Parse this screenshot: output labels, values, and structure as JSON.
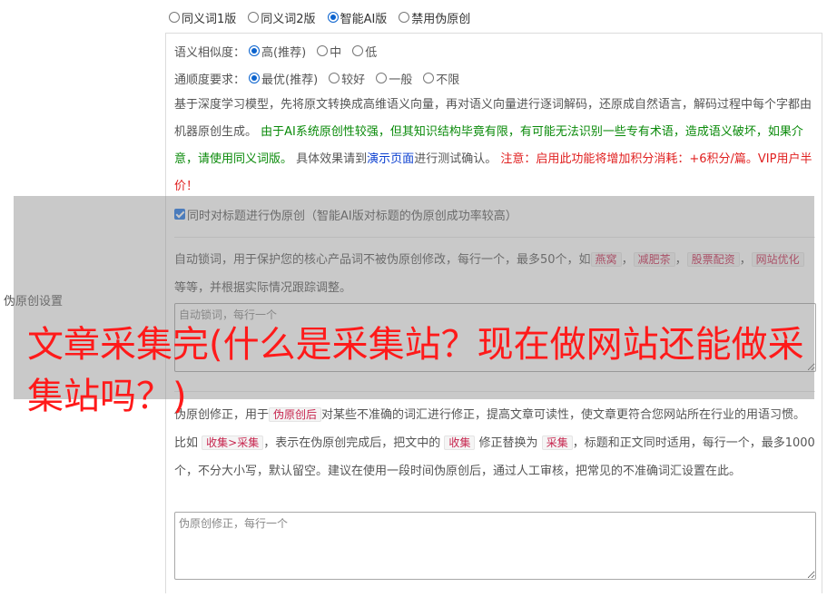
{
  "side_label": "伪原创设置",
  "mode": {
    "options": [
      "同义词1版",
      "同义词2版",
      "智能AI版",
      "禁用伪原创"
    ],
    "selected_index": 2
  },
  "similarity": {
    "label": "语义相似度：",
    "options": [
      "高(推荐)",
      "中",
      "低"
    ],
    "selected_index": 0
  },
  "fluency": {
    "label": "通顺度要求：",
    "options": [
      "最优(推荐)",
      "较好",
      "一般",
      "不限"
    ],
    "selected_index": 0
  },
  "ai_description": {
    "p1": "基于深度学习模型，先将原文转换成高维语义向量，再对语义向量进行逐词解码，还原成自然语言，解码过程中每个字都由机器原创生成。",
    "p2_green": "由于AI系统原创性较强，但其知识结构毕竟有限，有可能无法识别一些专有术语，造成语义破坏，如果介意，请使用同义词版。",
    "p3_pre": "具体效果请到",
    "p3_link": "演示页面",
    "p3_post": "进行测试确认。",
    "p4_red": "注意：启用此功能将增加积分消耗：+6积分/篇。VIP用户半价！"
  },
  "title_checkbox": {
    "label": "同时对标题进行伪原创（智能AI版对标题的伪原创成功率较高）",
    "checked": true
  },
  "lock_words": {
    "desc_pre": "自动锁词，用于保护您的核心产品词不被伪原创修改，每行一个，最多50个，如",
    "examples": [
      "燕窝",
      "减肥茶",
      "股票配资",
      "网站优化"
    ],
    "sep": "，",
    "desc_post": "等等，并根据实际情况跟踪调整。",
    "placeholder": "自动锁词，每行一个"
  },
  "correction": {
    "desc_pre": "伪原创修正，用于",
    "tag1": "伪原创后",
    "desc_mid1": "对某些不准确的词汇进行修正，提高文章可读性，使文章更符合您网站所在行业的用语习惯。比如",
    "tag2": "收集>采集",
    "desc_mid2": "，表示在伪原创完成后，把文中的",
    "tag3": "收集",
    "desc_mid3": "修正替换为",
    "tag4": "采集",
    "desc_post": "，标题和正文同时适用，每行一个，最多1000个，不分大小写，默认留空。建议在使用一段时间伪原创后，通过人工审核，把常见的不准确词汇设置在此。",
    "placeholder": "伪原创修正，每行一个"
  },
  "overlay_headline": "文章采集完(什么是采集站？现在做网站还能做采集站吗？)",
  "colors": {
    "accent": "#0b63ce",
    "green_text": "#0a8a0a",
    "red_text": "#e02020",
    "headline": "#ff1a1a"
  }
}
